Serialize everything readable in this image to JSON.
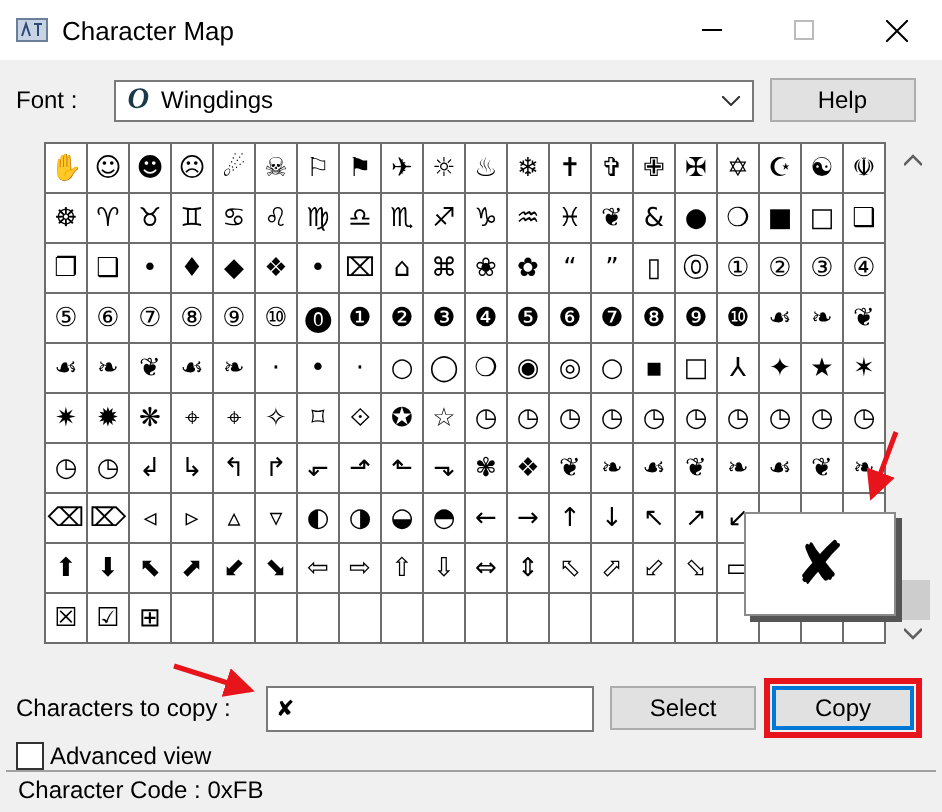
{
  "window": {
    "title": "Character Map"
  },
  "font": {
    "label": "Font :",
    "value": "Wingdings",
    "icon_glyph": "O"
  },
  "help_button": "Help",
  "grid": {
    "rows": [
      [
        "✋",
        "☺",
        "☻",
        "☹",
        "☄",
        "☠",
        "⚐",
        "⚑",
        "✈",
        "☼",
        "♨",
        "❄",
        "✝",
        "✞",
        "✙",
        "✠",
        "✡",
        "☪",
        "☯",
        "☫"
      ],
      [
        "☸",
        "♈",
        "♉",
        "♊",
        "♋",
        "♌",
        "♍",
        "♎",
        "♏",
        "♐",
        "♑",
        "♒",
        "♓",
        "❦",
        "&",
        "●",
        "❍",
        "■",
        "□",
        "❑"
      ],
      [
        "❐",
        "❑",
        "•",
        "♦",
        "◆",
        "❖",
        "•",
        "⌧",
        "⌂",
        "⌘",
        "❀",
        "✿",
        "“",
        "”",
        "▯",
        "⓪",
        "①",
        "②",
        "③",
        "④"
      ],
      [
        "⑤",
        "⑥",
        "⑦",
        "⑧",
        "⑨",
        "⑩",
        "⓿",
        "❶",
        "❷",
        "❸",
        "❹",
        "❺",
        "❻",
        "❼",
        "❽",
        "❾",
        "❿",
        "☙",
        "❧",
        "❦"
      ],
      [
        "☙",
        "❧",
        "❦",
        "☙",
        "❧",
        "·",
        "•",
        "·",
        "○",
        "◯",
        "❍",
        "◉",
        "◎",
        "○",
        "▪",
        "□",
        "⅄",
        "✦",
        "★",
        "✶"
      ],
      [
        "✷",
        "✹",
        "❋",
        "⌖",
        "⌖",
        "✧",
        "⌑",
        "⟐",
        "✪",
        "☆",
        "◷",
        "◷",
        "◷",
        "◷",
        "◷",
        "◷",
        "◷",
        "◷",
        "◷",
        "◷"
      ],
      [
        "◷",
        "◷",
        "↲",
        "↳",
        "↰",
        "↱",
        "⬐",
        "⬏",
        "⬑",
        "⬎",
        "✾",
        "❖",
        "❦",
        "❧",
        "☙",
        "❦",
        "❧",
        "☙",
        "❦",
        "❧"
      ],
      [
        "⌫",
        "⌦",
        "◃",
        "▹",
        "▵",
        "▿",
        "◐",
        "◑",
        "◒",
        "◓",
        "←",
        "→",
        "↑",
        "↓",
        "↖",
        "↗",
        "↙"
      ],
      [
        "⬆",
        "⬇",
        "⬉",
        "⬈",
        "⬋",
        "⬊",
        "⇦",
        "⇨",
        "⇧",
        "⇩",
        "⇔",
        "⇕",
        "⬁",
        "⬀",
        "⬃",
        "⬂",
        "▭"
      ],
      [
        "☒",
        "☑",
        "⊞"
      ]
    ]
  },
  "magnified": {
    "glyph": "✘"
  },
  "copy_row": {
    "label": "Characters to copy :",
    "value": "✘",
    "select_button": "Select",
    "copy_button": "Copy"
  },
  "advanced_view": {
    "label": "Advanced view",
    "checked": false
  },
  "status_bar": "Character Code : 0xFB"
}
